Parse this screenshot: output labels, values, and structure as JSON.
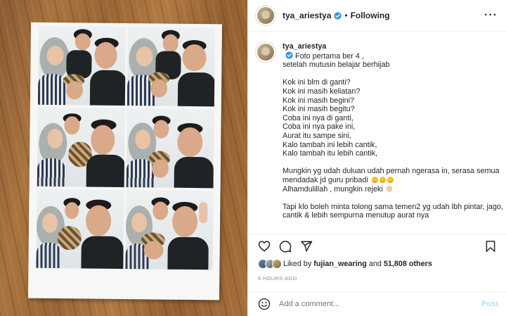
{
  "post": {
    "author": "tya_ariestya",
    "follow_status": "Following",
    "caption_lines": [
      "Foto pertama ber 4 ,",
      "setelah mutusin belajar berhijab",
      "",
      "Kok ini blm di ganti?",
      "Kok ini masih keliatan?",
      "Kok ini masih begini?",
      "Kok ini masih begitu?",
      "Coba ini nya di ganti,",
      "Coba ini nya pake ini,",
      "Aurat itu sampe sini,",
      "Kalo tambah ini lebih cantik,",
      "Kalo tambah itu lebih cantik,",
      "",
      "Mungkin yg udah duluan udah pernah ngerasa in, serasa semua",
      "mendadak jd guru pribadi",
      "Alhamdulillah , mungkin rejeki",
      "",
      "Tapi klo boleh minta tolong sama temen2 yg udah lbh pintar, jago,",
      "cantik & lebih sempurna menutup aurat nya"
    ],
    "likes": {
      "prefix": "Liked by",
      "user": "fujian_wearing",
      "joiner": "and",
      "count": "51,808 others"
    },
    "timestamp": "8 HOURS AGO"
  },
  "comment_box": {
    "placeholder": "Add a comment...",
    "post_label": "Post"
  },
  "icons": {
    "like": "heart-icon",
    "comment": "comment-icon",
    "share": "share-icon",
    "save": "bookmark-icon",
    "emoji": "smiley-icon",
    "verified": "verified-badge-icon",
    "more": "more-options-icon"
  },
  "colors": {
    "verified_blue": "#3897f0",
    "post_button": "#b2dffc",
    "muted_text": "#8e8e8e"
  }
}
